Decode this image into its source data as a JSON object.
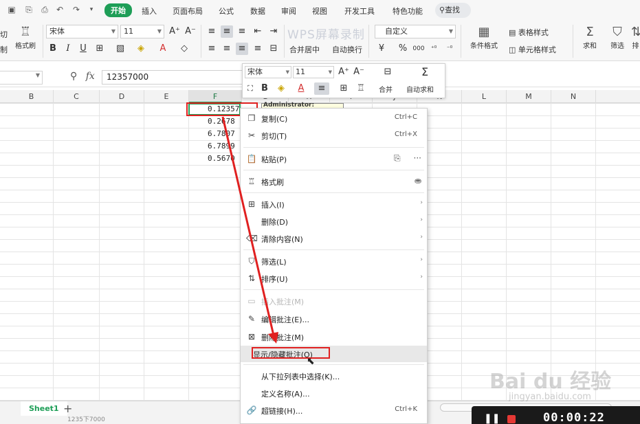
{
  "menu": {
    "tabs": [
      "开始",
      "插入",
      "页面布局",
      "公式",
      "数据",
      "审阅",
      "视图",
      "开发工具",
      "特色功能"
    ],
    "search": "查找"
  },
  "ribbon": {
    "cut_label": "切",
    "cut_sub": "制",
    "format_painter": "格式刷",
    "font_name": "宋体",
    "font_size": "11",
    "merge_center": "合并居中",
    "auto_wrap": "自动换行",
    "number_format": "自定义",
    "conditional_format": "条件格式",
    "table_style": "表格样式",
    "cell_style": "单元格样式",
    "sum": "求和",
    "filter": "筛选",
    "sort_cut": "排",
    "percent": "%",
    "thousands": "000",
    "watermark": "WPS屏幕录制"
  },
  "formula_bar": {
    "fx": "fx",
    "value": "12357000"
  },
  "columns": [
    "B",
    "C",
    "D",
    "E",
    "F",
    "G",
    "H",
    "I",
    "J",
    "K",
    "L",
    "M",
    "N"
  ],
  "cells": [
    "0.12357",
    "0.2678",
    "6.7807",
    "6.7899",
    "0.5670"
  ],
  "comment_author": "Administrator:",
  "mini_toolbar": {
    "font_name": "宋体",
    "font_size": "11",
    "merge": "合并",
    "auto_sum": "自动求和"
  },
  "context_menu": {
    "copy": "复制(C)",
    "copy_sc": "Ctrl+C",
    "cut": "剪切(T)",
    "cut_sc": "Ctrl+X",
    "paste": "粘贴(P)",
    "paste_more": "···",
    "format_painter": "格式刷",
    "insert": "插入(I)",
    "delete": "删除(D)",
    "clear": "清除内容(N)",
    "filter": "筛选(L)",
    "sort": "排序(U)",
    "insert_comment": "插入批注(M)",
    "edit_comment": "编辑批注(E)...",
    "delete_comment": "删除批注(M)",
    "toggle_comment": "显示/隐藏批注(O)",
    "pick_list": "从下拉列表中选择(K)...",
    "define_name": "定义名称(A)...",
    "hyperlink": "超链接(H)...",
    "hyperlink_sc": "Ctrl+K"
  },
  "sheet_tab": "Sheet1",
  "status": "1235下7000",
  "recorder": {
    "time": "00:00:22"
  },
  "brand_watermark": {
    "main": "Bai du 经验",
    "sub": "jingyan.baidu.com"
  },
  "colors": {
    "accent": "#1e9e57",
    "highlight": "#e02020"
  }
}
